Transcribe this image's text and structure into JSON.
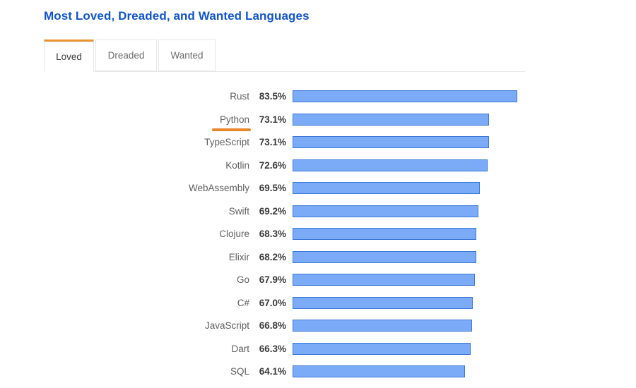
{
  "page_title": "Most Loved, Dreaded, and Wanted Languages",
  "colors": {
    "title": "#1155cc",
    "tab_active_accent": "#e8912d",
    "highlight_underline": "#e8862a",
    "bar_fill": "#7baaf7",
    "bar_border": "#3c78d8",
    "border": "#e6e6e6"
  },
  "tabs": [
    {
      "label": "Loved",
      "active": true
    },
    {
      "label": "Dreaded",
      "active": false
    },
    {
      "label": "Wanted",
      "active": false
    }
  ],
  "chart_data": {
    "type": "bar",
    "orientation": "horizontal",
    "title": "Most Loved, Dreaded, and Wanted Languages",
    "xlabel": "",
    "ylabel": "",
    "grid": false,
    "legend": false,
    "value_suffix": "%",
    "highlighted_category": "Python",
    "categories": [
      "Rust",
      "Python",
      "TypeScript",
      "Kotlin",
      "WebAssembly",
      "Swift",
      "Clojure",
      "Elixir",
      "Go",
      "C#",
      "JavaScript",
      "Dart",
      "SQL"
    ],
    "values": [
      83.5,
      73.1,
      73.1,
      72.6,
      69.5,
      69.2,
      68.3,
      68.2,
      67.9,
      67.0,
      66.8,
      66.3,
      64.1
    ],
    "value_labels": [
      "83.5%",
      "73.1%",
      "73.1%",
      "72.6%",
      "69.5%",
      "69.2%",
      "68.3%",
      "68.2%",
      "67.9%",
      "67.0%",
      "66.8%",
      "66.3%",
      "64.1%"
    ]
  }
}
